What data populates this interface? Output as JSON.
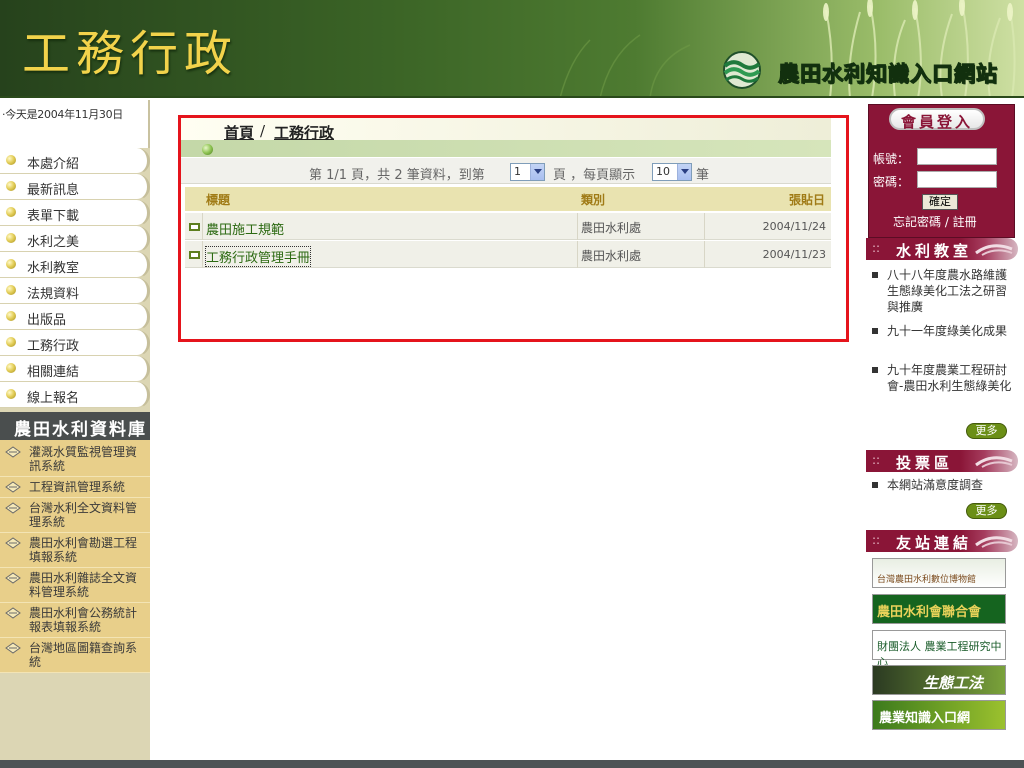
{
  "header": {
    "site_title": "工務行政",
    "portal_name": "農田水利知識入口網站"
  },
  "left_sidebar": {
    "date_text": "‧今天是2004年11月30日",
    "menu": [
      {
        "label": "本處介紹"
      },
      {
        "label": "最新訊息"
      },
      {
        "label": "表單下載"
      },
      {
        "label": "水利之美"
      },
      {
        "label": "水利教室"
      },
      {
        "label": "法規資料"
      },
      {
        "label": "出版品"
      },
      {
        "label": "工務行政"
      },
      {
        "label": "相關連結"
      },
      {
        "label": "線上報名"
      }
    ],
    "database_title": "農田水利資料庫",
    "database_items": [
      {
        "label": "灌溉水質監視管理資訊系統"
      },
      {
        "label": "工程資訊管理系統"
      },
      {
        "label": "台灣水利全文資料管理系統"
      },
      {
        "label": "農田水利會勘選工程填報系統"
      },
      {
        "label": "農田水利雜誌全文資料管理系統"
      },
      {
        "label": "農田水利會公務統計報表填報系統"
      },
      {
        "label": "台灣地區圖籍查詢系統"
      }
    ]
  },
  "main": {
    "breadcrumb": {
      "home": "首頁",
      "separator": "/",
      "current": "工務行政"
    },
    "pager": {
      "text_before_page": "第 1/1 頁，共 2 筆資料，到第",
      "page_select": "1",
      "text_between": "頁 ，每頁顯示",
      "per_page_select": "10",
      "text_after": "筆"
    },
    "table": {
      "headers": {
        "title": "標題",
        "category": "類別",
        "date": "張貼日"
      },
      "rows": [
        {
          "title": "農田施工規範",
          "category": "農田水利處",
          "date": "2004/11/24"
        },
        {
          "title": "工務行政管理手冊",
          "category": "農田水利處",
          "date": "2004/11/23"
        }
      ]
    }
  },
  "right_sidebar": {
    "login": {
      "title": "會員登入",
      "account_label": "帳號：",
      "password_label": "密碼：",
      "submit": "確定",
      "forgot_register": "忘記密碼 / 註冊"
    },
    "water_class": {
      "title": "水利教室",
      "items": [
        "八十八年度農水路維護生態綠美化工法之研習與推廣",
        "九十一年度綠美化成果",
        "九十年度農業工程研討會-農田水利生態綠美化"
      ],
      "more": "更多"
    },
    "poll": {
      "title": "投票區",
      "items": [
        "本網站滿意度調查"
      ],
      "more": "更多"
    },
    "friend_links": {
      "title": "友站連結",
      "banners": [
        {
          "text": "台灣農田水利數位博物館"
        },
        {
          "text": "農田水利會聯合會"
        },
        {
          "text": "財團法人 農業工程研究中心"
        },
        {
          "text": "生態工法"
        },
        {
          "text": "農業知識入口網"
        }
      ]
    }
  },
  "colors": {
    "header_green": "#3b6426",
    "title_gold": "#f2d34b",
    "highlight_red": "#e5141c",
    "maroon": "#8a1537",
    "olive_button": "#6b8f16",
    "sidebar_beige": "#dcd6b4",
    "database_tan": "#e8cf8a"
  }
}
